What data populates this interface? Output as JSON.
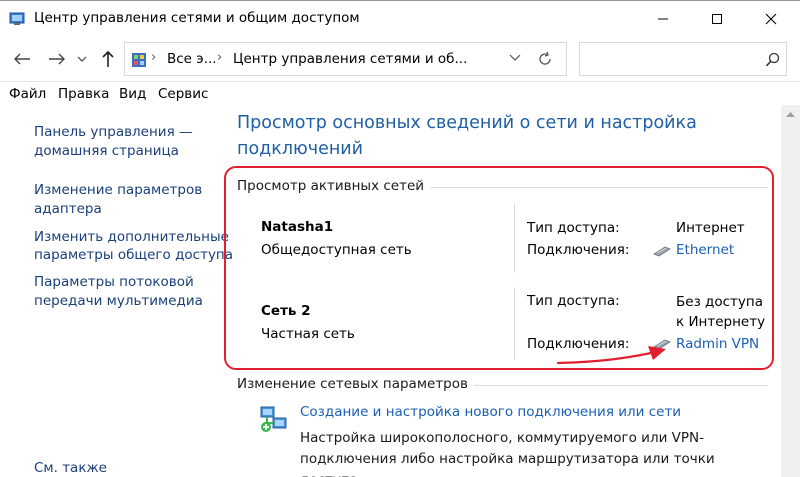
{
  "window": {
    "title": "Центр управления сетями и общим доступом"
  },
  "navigation": {
    "breadcrumbs": [
      "Все э...",
      "Центр управления сетями и об..."
    ]
  },
  "menu": [
    "Файл",
    "Правка",
    "Вид",
    "Сервис"
  ],
  "sidebar": {
    "home_link": [
      "Панель управления —",
      "домашняя страница"
    ],
    "adapter_link": [
      "Изменение параметров",
      "адаптера"
    ],
    "sharing_link": [
      "Изменить дополнительные",
      "параметры общего доступа"
    ],
    "streaming_link": [
      "Параметры потоковой",
      "передачи мультимедиа"
    ],
    "see_also": "См. также"
  },
  "main": {
    "title": "Просмотр основных сведений о сети и настройка подключений",
    "active_networks_title": "Просмотр активных сетей",
    "access_label": "Тип доступа:",
    "connections_label": "Подключения:",
    "networks": [
      {
        "name": "Natasha1",
        "type": "Общедоступная сеть",
        "access": "Интернет",
        "connection": "Ethernet"
      },
      {
        "name": "Сеть 2",
        "type": "Частная сеть",
        "access": "Без доступа к Интернету",
        "connection": "Radmin VPN"
      }
    ],
    "change_settings_title": "Изменение сетевых параметров",
    "new_connection_link": "Создание и настройка нового подключения или сети",
    "new_connection_desc": "Настройка широкополосного, коммутируемого или VPN-подключения либо настройка маршрутизатора или точки доступа."
  },
  "colors": {
    "link": "#1a5fb4",
    "title": "#1e5fa5",
    "highlight": "#e0202e"
  }
}
